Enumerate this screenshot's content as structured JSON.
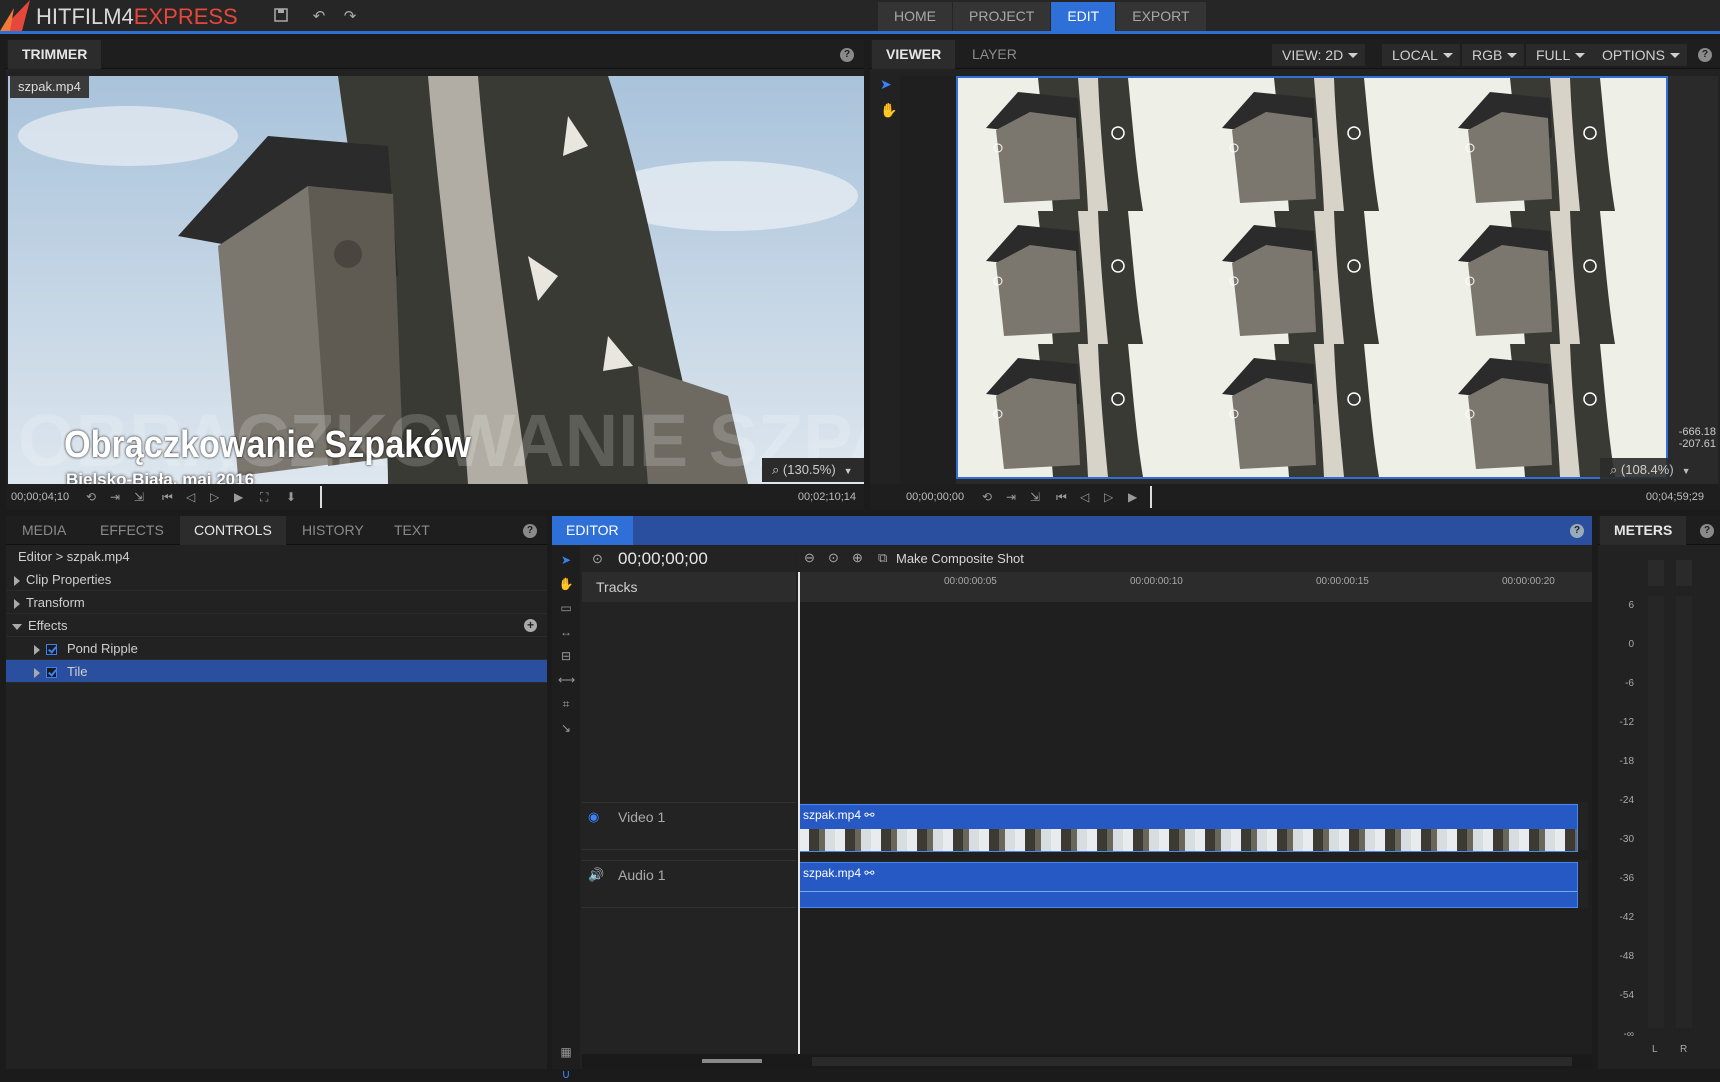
{
  "app": {
    "logo_main": "HITFILM4",
    "logo_accent": "EXPRESS",
    "nav_tabs": [
      "HOME",
      "PROJECT",
      "EDIT",
      "EXPORT"
    ],
    "active_nav": "EDIT"
  },
  "trimmer": {
    "tab": "TRIMMER",
    "clip_name": "szpak.mp4",
    "overlay_title": "Obrączkowanie Szpaków",
    "overlay_subtitle": "Bielsko-Biała, maj 2016",
    "zoom": "(130.5%)",
    "timecode_in": "00;00;04;10",
    "timecode_duration": "00;02;10;14"
  },
  "viewer": {
    "tabs": [
      "VIEWER",
      "LAYER"
    ],
    "active_tab": "VIEWER",
    "view_mode": "VIEW: 2D",
    "space": "LOCAL",
    "channels": "RGB",
    "resolution": "FULL",
    "options": "OPTIONS",
    "coord_x": "-666.18",
    "coord_y": "-207.61",
    "zoom": "(108.4%)",
    "timecode_current": "00;00;00;00",
    "timecode_end": "00;04;59;29"
  },
  "controls": {
    "tabs": [
      "MEDIA",
      "EFFECTS",
      "CONTROLS",
      "HISTORY",
      "TEXT"
    ],
    "active_tab": "CONTROLS",
    "breadcrumb": "Editor > szpak.mp4",
    "rows": [
      {
        "label": "Clip Properties",
        "expanded": false
      },
      {
        "label": "Transform",
        "expanded": false
      },
      {
        "label": "Effects",
        "expanded": true
      }
    ],
    "effects": [
      {
        "label": "Pond Ripple",
        "checked": true,
        "selected": false
      },
      {
        "label": "Tile",
        "checked": true,
        "selected": true
      }
    ]
  },
  "editor": {
    "tab": "EDITOR",
    "timecode": "00;00;00;00",
    "composite_label": "Make Composite Shot",
    "tracks_label": "Tracks",
    "ruler": [
      "00:00:00:05",
      "00:00:00:10",
      "00:00:00:15",
      "00:00:00:20"
    ],
    "video_track": "Video 1",
    "audio_track": "Audio 1",
    "video_clip": "szpak.mp4",
    "audio_clip": "szpak.mp4"
  },
  "meters": {
    "tab": "METERS",
    "scale": [
      "6",
      "0",
      "-6",
      "-12",
      "-18",
      "-24",
      "-30",
      "-36",
      "-42",
      "-48",
      "-54",
      "-∞"
    ],
    "channels": [
      "L",
      "R"
    ]
  },
  "colors": {
    "accent": "#2e6fd8",
    "clip": "#2759c4",
    "logo_red": "#e5473a"
  }
}
